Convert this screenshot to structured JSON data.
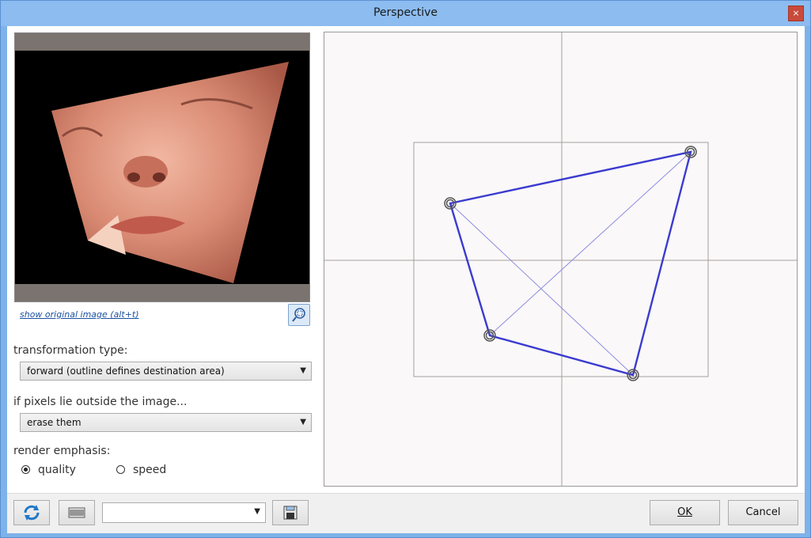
{
  "window": {
    "title": "Perspective",
    "close_glyph": "×"
  },
  "preview": {
    "show_original_link": "show original image (alt+t)"
  },
  "transformation": {
    "label": "transformation type:",
    "selected": "forward (outline defines destination area)"
  },
  "outside_pixels": {
    "label": "if pixels lie outside the image...",
    "selected": "erase them"
  },
  "render": {
    "label": "render emphasis:",
    "options": [
      {
        "label": "quality",
        "checked": true
      },
      {
        "label": "speed",
        "checked": false
      }
    ]
  },
  "buttons": {
    "ok": "OK",
    "cancel": "Cancel"
  },
  "presets": {
    "selected": ""
  },
  "colors": {
    "outline": "#3b3bd0",
    "handle": "#555555",
    "grid": "#a89e9e"
  }
}
